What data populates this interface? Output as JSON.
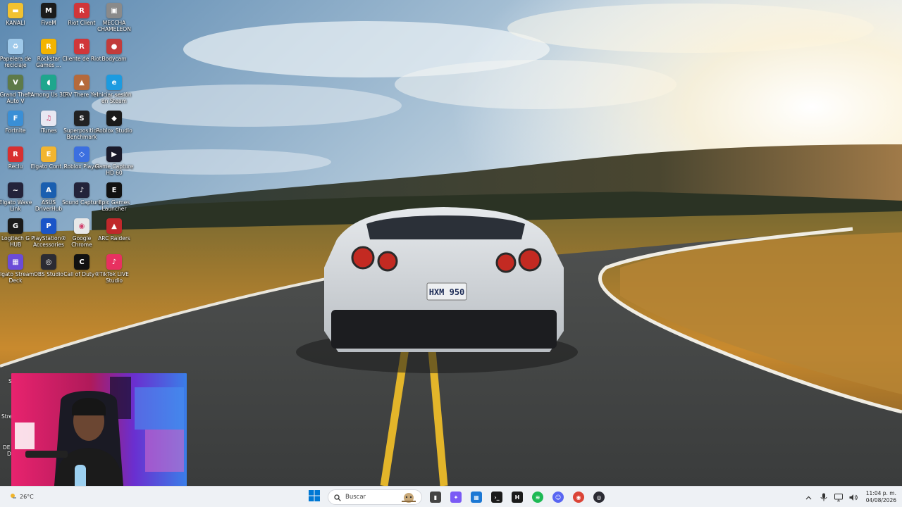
{
  "desktop": {
    "icons": [
      {
        "label": "KANALI",
        "icon": "folder-icon",
        "color": "#f2c230"
      },
      {
        "label": "FiveM",
        "icon": "fivem-icon",
        "color": "#1b1b1b"
      },
      {
        "label": "Riot Client",
        "icon": "riot-client-icon",
        "color": "#d13639"
      },
      {
        "label": "MECCHA CHAMELEON",
        "icon": "game-icon",
        "color": "#8a8a8a"
      },
      {
        "label": "Papelera de reciclaje",
        "icon": "recycle-bin-icon",
        "color": "#9ec9ea"
      },
      {
        "label": "Rockstar Games ...",
        "icon": "rockstar-icon",
        "color": "#f4b400"
      },
      {
        "label": "Cliente de Riot",
        "icon": "riot-client-icon",
        "color": "#d13639"
      },
      {
        "label": "Bodycam",
        "icon": "bodycam-icon",
        "color": "#c23b3b"
      },
      {
        "label": "Grand Theft Auto V",
        "icon": "gta-icon",
        "color": "#5e7a48"
      },
      {
        "label": "Among Us 3D",
        "icon": "among-us-icon",
        "color": "#1fa68d"
      },
      {
        "label": "RV There Yet",
        "icon": "rv-icon",
        "color": "#b56a3c"
      },
      {
        "label": "Iniciar sesión en Steam",
        "icon": "edge-icon",
        "color": "#1c9be0"
      },
      {
        "label": "Fortnite",
        "icon": "fortnite-icon",
        "color": "#3a8fd6"
      },
      {
        "label": "iTunes",
        "icon": "itunes-icon",
        "color": "#e8e8f2"
      },
      {
        "label": "Superposition Benchmark",
        "icon": "benchmark-icon",
        "color": "#222222"
      },
      {
        "label": "Roblox Studio",
        "icon": "roblox-studio-icon",
        "color": "#1a1a1a"
      },
      {
        "label": "Reclu",
        "icon": "app-icon",
        "color": "#d83030"
      },
      {
        "label": "Elgato Cont...",
        "icon": "elgato-icon",
        "color": "#f2b530"
      },
      {
        "label": "Roblox Player",
        "icon": "roblox-icon",
        "color": "#3b6fe0"
      },
      {
        "label": "Game Capture HD 60",
        "icon": "game-capture-icon",
        "color": "#1a1a2a"
      },
      {
        "label": "Elgato Wave Link",
        "icon": "wave-link-icon",
        "color": "#23233a"
      },
      {
        "label": "ASUS DriverHub",
        "icon": "asus-icon",
        "color": "#1a5fb0"
      },
      {
        "label": "Sound Capture",
        "icon": "sound-capture-icon",
        "color": "#23233a"
      },
      {
        "label": "Epic Games Launcher",
        "icon": "epic-icon",
        "color": "#111111"
      },
      {
        "label": "Logitech G HUB",
        "icon": "logitech-icon",
        "color": "#1a1a1a"
      },
      {
        "label": "PlayStation® Accessories",
        "icon": "playstation-icon",
        "color": "#1a55c8"
      },
      {
        "label": "Google Chrome",
        "icon": "chrome-icon",
        "color": "#e8e8e8"
      },
      {
        "label": "ARC Raiders",
        "icon": "arc-raiders-icon",
        "color": "#c0282b"
      },
      {
        "label": "Elgato Stream Deck",
        "icon": "stream-deck-icon",
        "color": "#6b4cd8"
      },
      {
        "label": "OBS Studio",
        "icon": "obs-icon",
        "color": "#2b2b33"
      },
      {
        "label": "Call of Duty®",
        "icon": "cod-icon",
        "color": "#111111"
      },
      {
        "label": "TikTok LIVE Studio",
        "icon": "tiktok-icon",
        "color": "#e83060"
      }
    ],
    "partial_labels": [
      "S",
      "Stre",
      "DE",
      "D"
    ]
  },
  "taskbar": {
    "weather_temp": "26°C",
    "search_placeholder": "Buscar",
    "apps": [
      {
        "name": "task-view-icon",
        "color": "#444444"
      },
      {
        "name": "copilot-icon",
        "color": "#7a5af5"
      },
      {
        "name": "microsoft-store-icon",
        "color": "#1c78d4"
      },
      {
        "name": "terminal-icon",
        "color": "#1a1a1a"
      },
      {
        "name": "app-h-icon",
        "color": "#1a1a1a"
      },
      {
        "name": "spotify-icon",
        "color": "#1db954"
      },
      {
        "name": "discord-icon",
        "color": "#5865f2"
      },
      {
        "name": "chrome-icon",
        "color": "#db4437"
      },
      {
        "name": "obs-icon",
        "color": "#2b2b33"
      }
    ],
    "time": "11:04 p. m.",
    "date": "04/08/2026"
  },
  "wallpaper": {
    "license_plate": "HXM 950"
  },
  "colors": {
    "taskbar_bg": "#eef1f5",
    "accent": "#0078d4",
    "road_line": "#e3b52a"
  }
}
